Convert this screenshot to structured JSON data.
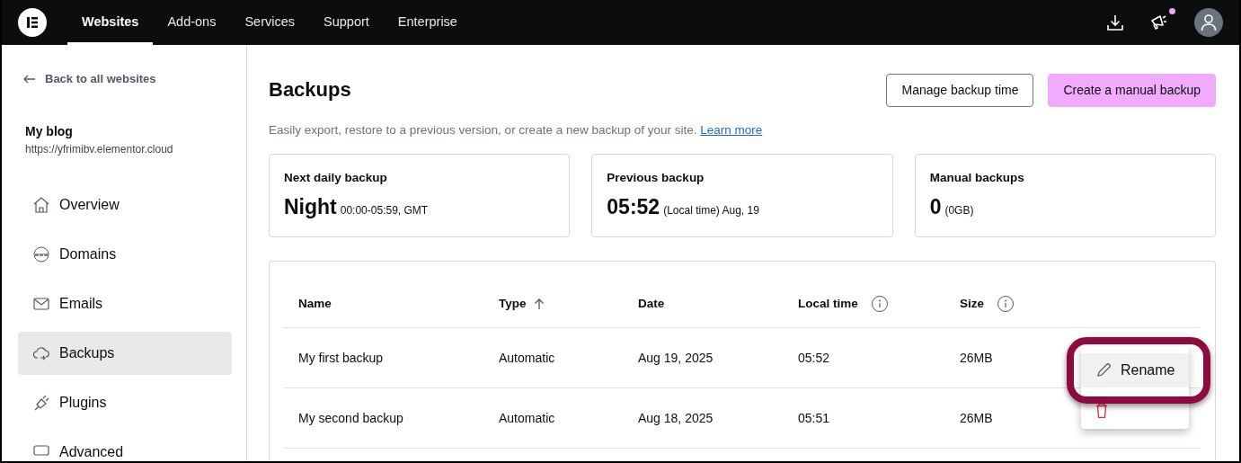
{
  "topbar": {
    "tabs": [
      {
        "label": "Websites",
        "selected": true
      },
      {
        "label": "Add-ons",
        "selected": false
      },
      {
        "label": "Services",
        "selected": false
      },
      {
        "label": "Support",
        "selected": false
      },
      {
        "label": "Enterprise",
        "selected": false
      }
    ],
    "notification": true
  },
  "sidebar": {
    "back_link": "Back to all websites",
    "site_name": "My blog",
    "site_url": "https://yfrimibv.elementor.cloud",
    "items": [
      {
        "label": "Overview",
        "kind": "home",
        "selected": false
      },
      {
        "label": "Domains",
        "kind": "www",
        "selected": false
      },
      {
        "label": "Emails",
        "kind": "mail",
        "selected": false
      },
      {
        "label": "Backups",
        "kind": "cloud",
        "selected": true
      },
      {
        "label": "Plugins",
        "kind": "plug",
        "selected": false
      },
      {
        "label": "Advanced",
        "kind": "window",
        "selected": false
      }
    ]
  },
  "page": {
    "title": "Backups",
    "buttons": [
      {
        "label": "Manage backup time",
        "kind": "outline"
      },
      {
        "label": "Create a manual backup",
        "kind": "primary"
      }
    ],
    "description": "Easily export, restore to a previous version, or create a new backup of your site.",
    "learn_more": "Learn more",
    "stats": [
      {
        "label": "Next daily backup",
        "value": "Night",
        "detail": "00:00-05:59, GMT"
      },
      {
        "label": "Previous backup",
        "value": "05:52",
        "detail": "(Local time) Aug, 19"
      },
      {
        "label": "Manual backups",
        "value": "0",
        "detail": "(0GB)"
      }
    ]
  },
  "table": {
    "columns": [
      {
        "label": "Name",
        "sorted": false,
        "info": false
      },
      {
        "label": "Type",
        "sorted": true,
        "info": false
      },
      {
        "label": "Date",
        "sorted": false,
        "info": false
      },
      {
        "label": "Local time",
        "sorted": false,
        "info": true
      },
      {
        "label": "Size",
        "sorted": false,
        "info": true
      }
    ],
    "rows": [
      [
        "My first backup",
        "Automatic",
        "Aug 19, 2025",
        "05:52",
        "26MB"
      ],
      [
        "My second backup",
        "Automatic",
        "Aug 18, 2025",
        "05:51",
        "26MB"
      ]
    ]
  },
  "context_menu": {
    "items": [
      {
        "kind": "rename",
        "label": "Rename",
        "highlighted": true
      },
      {
        "kind": "delete",
        "highlighted": false
      }
    ]
  }
}
